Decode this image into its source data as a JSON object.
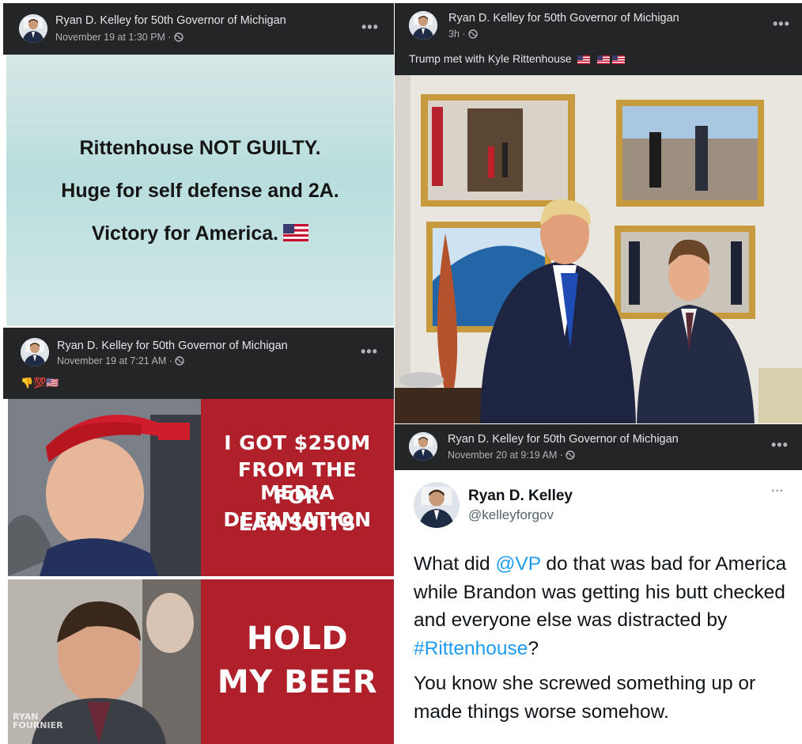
{
  "post_top_left": {
    "author": "Ryan D. Kelley for 50th Governor of Michigan",
    "meta": "November 19 at 1:30 PM · ",
    "menu": "•••",
    "card_lines": [
      "Rittenhouse NOT GUILTY.",
      "Huge for self defense and 2A.",
      "Victory for America."
    ]
  },
  "post_top_right": {
    "author": "Ryan D. Kelley for 50th Governor of Michigan",
    "meta": "3h · ",
    "menu": "•••",
    "caption": "Trump met with Kyle Rittenhouse"
  },
  "post_bottom_left": {
    "author": "Ryan D. Kelley for 50th Governor of Michigan",
    "meta": "November 19 at 7:21 AM · ",
    "menu": "•••",
    "caption_emoji": "👎💯🇺🇸",
    "meme_top": [
      "I GOT $250M",
      "FROM THE MEDIA",
      "FOR DEFAMATION",
      "LAWSUITS"
    ],
    "meme_bottom": [
      "HOLD",
      "MY BEER"
    ],
    "watermark": "RYAN FOURNIER"
  },
  "post_bottom_right": {
    "author": "Ryan D. Kelley for 50th Governor of Michigan",
    "meta": "November 20 at 9:19 AM · ",
    "menu": "•••",
    "tweet": {
      "name": "Ryan D. Kelley",
      "handle": "@kelleyforgov",
      "menu": "···",
      "p1_a": "What did ",
      "p1_mention": "@VP",
      "p1_b": " do that was bad for America while Brandon was getting his butt checked and everyone else was distracted by ",
      "p1_hashtag": "#Rittenhouse",
      "p1_c": "?",
      "p2": "You know she screwed something up or made things worse somehow."
    }
  },
  "colors": {
    "header_bg": "#242526",
    "meme_red": "#b0202b",
    "link_blue": "#1d9bf0"
  }
}
